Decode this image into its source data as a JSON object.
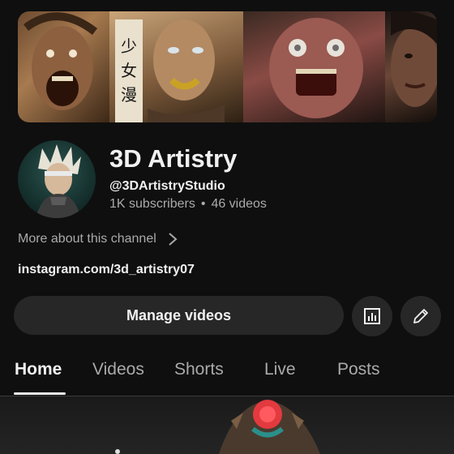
{
  "banner": {
    "panels": [
      "screaming-man",
      "armored-woman",
      "zombie",
      "woman-portrait"
    ],
    "calligraphy": "少女漫画"
  },
  "channel": {
    "name": "3D Artistry",
    "handle": "@3DArtistryStudio",
    "subscribers": "1K subscribers",
    "separator": "•",
    "videos": "46 videos"
  },
  "more_about": {
    "label": "More about this channel",
    "icon": "chevron-right-icon"
  },
  "link": {
    "text": "instagram.com/3d_artistry07"
  },
  "actions": {
    "manage_label": "Manage videos",
    "analytics_icon": "analytics-icon",
    "edit_icon": "edit-pencil-icon"
  },
  "tabs": [
    {
      "label": "Home",
      "active": true
    },
    {
      "label": "Videos",
      "active": false
    },
    {
      "label": "Shorts",
      "active": false
    },
    {
      "label": "Live",
      "active": false
    },
    {
      "label": "Posts",
      "active": false
    }
  ],
  "colors": {
    "background": "#0f0f0f",
    "button": "#272727",
    "text_primary": "#f1f1f1",
    "text_secondary": "#aaaaaa"
  }
}
